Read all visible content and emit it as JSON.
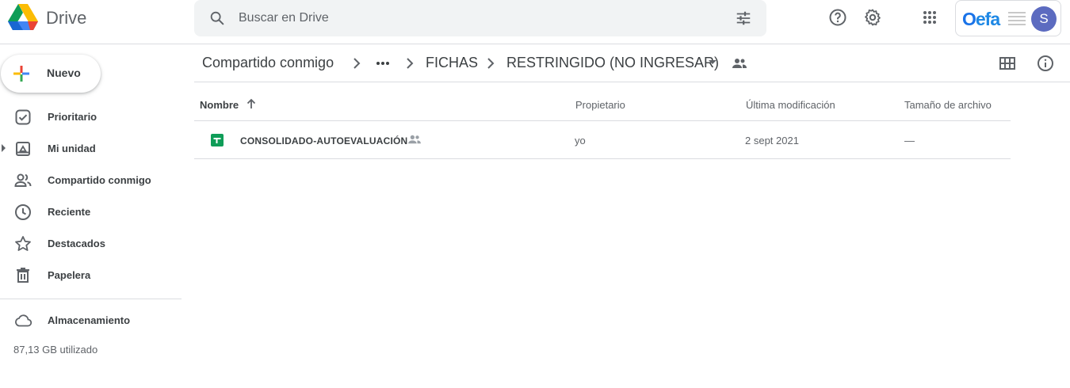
{
  "header": {
    "app_name": "Drive",
    "search_placeholder": "Buscar en Drive",
    "org_logo_text_o": "O",
    "org_logo_text_rest": "efa",
    "avatar_letter": "S"
  },
  "sidebar": {
    "new_label": "Nuevo",
    "items": [
      {
        "label": "Prioritario",
        "icon": "priority-icon"
      },
      {
        "label": "Mi unidad",
        "icon": "my-drive-icon"
      },
      {
        "label": "Compartido conmigo",
        "icon": "shared-with-me-icon"
      },
      {
        "label": "Reciente",
        "icon": "clock-icon"
      },
      {
        "label": "Destacados",
        "icon": "star-icon"
      },
      {
        "label": "Papelera",
        "icon": "trash-icon"
      }
    ],
    "storage": {
      "label": "Almacenamiento",
      "used": "87,13 GB utilizado"
    }
  },
  "breadcrumb": {
    "items": [
      "Compartido conmigo",
      "FICHAS",
      "RESTRINGIDO (NO INGRESAR)"
    ]
  },
  "table": {
    "columns": [
      "Nombre",
      "Propietario",
      "Última modificación",
      "Tamaño de archivo"
    ],
    "rows": [
      {
        "name": "CONSOLIDADO-AUTOEVALUACIÓN",
        "owner": "yo",
        "modified": "2 sept 2021",
        "size": "—",
        "type_icon": "sheets-icon",
        "shared": true
      }
    ]
  },
  "colors": {
    "accent": "#1a73e8",
    "sheets_green": "#0f9d58",
    "border": "#dadce0",
    "text": "#3c4043",
    "muted": "#5f6368"
  }
}
